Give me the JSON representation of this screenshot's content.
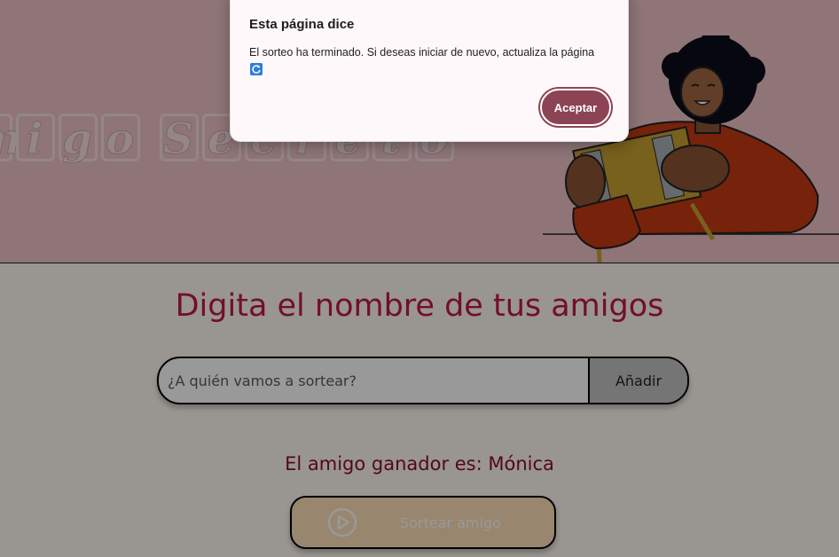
{
  "page": {
    "banner_letters": [
      "m",
      "i",
      "g",
      "o",
      "",
      "S",
      "e",
      "c",
      "r",
      "e",
      "t",
      "o"
    ],
    "section_title": "Digita el nombre de tus amigos",
    "input": {
      "placeholder": "¿A quién vamos a sortear?",
      "value": ""
    },
    "add_button_label": "Añadir",
    "result_text": "El amigo ganador es: Mónica",
    "draw_button_label": "Sortear amigo",
    "draw_button_icon": "play-circle-icon"
  },
  "dialog": {
    "title": "Esta página dice",
    "message": "El sorteo ha terminado. Si deseas iniciar de nuevo, actualiza la página",
    "message_icon": "refresh-emoji-icon",
    "ok_label": "Aceptar"
  },
  "colors": {
    "header_bg": "#efc4c8",
    "main_bg": "#fff8f0",
    "title_color": "#c0184a",
    "result_color": "#8b0b3a",
    "draw_button_bg": "#fde0b8",
    "dialog_button": "#8c4455"
  }
}
